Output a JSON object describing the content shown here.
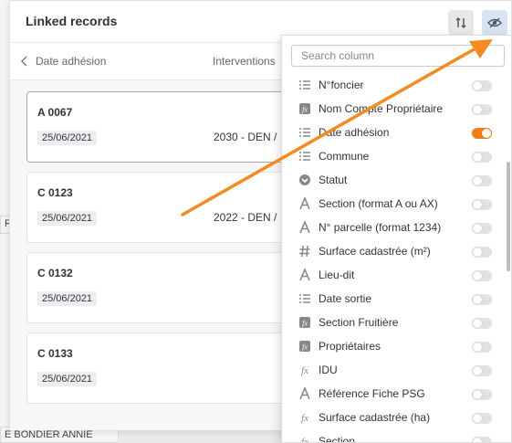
{
  "background": {
    "cell_left": "RE",
    "cell_bottom": "E BONDIER ANNIE"
  },
  "panel": {
    "title": "Linked records",
    "sort_icon": "sort-arrows-icon",
    "eye_icon": "eye-slash-icon",
    "date_column": "Date adhésion",
    "interventions_column": "Interventions"
  },
  "records": [
    {
      "title": "A 0067",
      "date": "25/06/2021",
      "intervention": "2030 - DEN /"
    },
    {
      "title": "C 0123",
      "date": "25/06/2021",
      "intervention": "2022 - DEN /"
    },
    {
      "title": "C 0132",
      "date": "25/06/2021",
      "intervention": ""
    },
    {
      "title": "C 0133",
      "date": "25/06/2021",
      "intervention": ""
    }
  ],
  "column_menu": {
    "search_placeholder": "Search column",
    "columns": [
      {
        "label": "N°foncier",
        "icon": "list-icon",
        "enabled": false
      },
      {
        "label": "Nom Compte Propriétaire",
        "icon": "formula-box-icon",
        "enabled": false
      },
      {
        "label": "Date adhésion",
        "icon": "list-icon",
        "enabled": true
      },
      {
        "label": "Commune",
        "icon": "list-icon",
        "enabled": false
      },
      {
        "label": "Statut",
        "icon": "chevron-circle-icon",
        "enabled": false
      },
      {
        "label": "Section (format A ou AX)",
        "icon": "text-a-icon",
        "enabled": false
      },
      {
        "label": "N° parcelle (format 1234)",
        "icon": "text-a-icon",
        "enabled": false
      },
      {
        "label": "Surface cadastrée (m²)",
        "icon": "hash-icon",
        "enabled": false
      },
      {
        "label": "Lieu-dit",
        "icon": "text-a-icon",
        "enabled": false
      },
      {
        "label": "Date sortie",
        "icon": "list-icon",
        "enabled": false
      },
      {
        "label": "Section Fruitière",
        "icon": "formula-box-icon",
        "enabled": false
      },
      {
        "label": "Propriétaires",
        "icon": "formula-box-icon",
        "enabled": false
      },
      {
        "label": "IDU",
        "icon": "fx-icon",
        "enabled": false
      },
      {
        "label": "Référence Fiche PSG",
        "icon": "text-a-icon",
        "enabled": false
      },
      {
        "label": "Surface cadastrée (ha)",
        "icon": "fx-icon",
        "enabled": false
      },
      {
        "label": "Section",
        "icon": "fx-icon",
        "enabled": false
      }
    ]
  },
  "colors": {
    "accent": "#f47f16",
    "annotation_arrow": "#f58a1f",
    "eye_button_bg": "#d8e4f2"
  }
}
